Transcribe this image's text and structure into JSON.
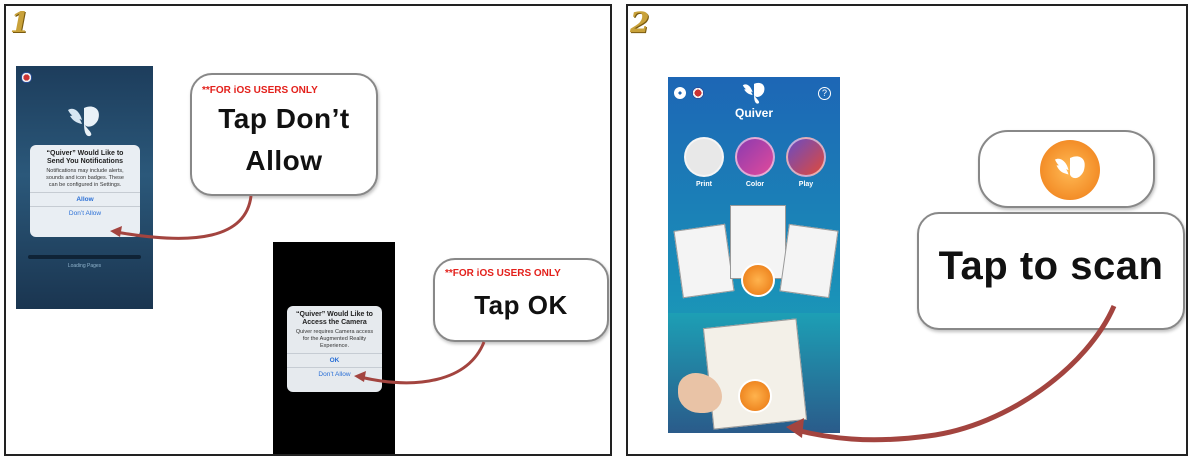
{
  "step1": {
    "number": "1",
    "callout1": {
      "note": "**FOR iOS USERS ONLY",
      "text_line1": "Tap Don’t",
      "text_line2": "Allow"
    },
    "callout2": {
      "note": "**FOR iOS USERS ONLY",
      "text": "Tap OK"
    },
    "phone1": {
      "dialog_title": "“Quiver” Would Like to Send You Notifications",
      "dialog_message": "Notifications may include alerts, sounds and icon badges. These can be configured in Settings.",
      "allow_label": "Allow",
      "dont_allow_label": "Don’t Allow",
      "loading_text": "Loading Pages"
    },
    "phone2": {
      "dialog_title": "“Quiver” Would Like to Access the Camera",
      "dialog_message": "Quiver requires Camera access for the Augmented Reality Experience.",
      "ok_label": "OK",
      "dont_allow_label": "Don’t Allow"
    }
  },
  "step2": {
    "number": "2",
    "app": {
      "name": "Quiver",
      "tabs": [
        {
          "label": "Print"
        },
        {
          "label": "Color"
        },
        {
          "label": "Play"
        }
      ]
    },
    "callout": {
      "text": "Tap to scan"
    }
  },
  "colors": {
    "arrow": "#a3443f",
    "note_red": "#e3201b",
    "orange": "#f08a1c",
    "app_blue": "#1f67b3"
  },
  "icons": [
    "gear-icon",
    "flag-icon",
    "help-icon",
    "butterfly-logo-icon",
    "scan-button-icon",
    "book-icon"
  ]
}
